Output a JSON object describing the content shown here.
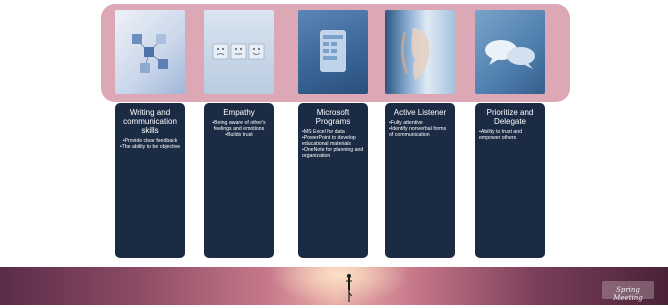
{
  "cards": [
    {
      "title": "Writing and communication skills",
      "bullets": [
        "•Provide clear feedback",
        "•The ability to be objective"
      ],
      "image_icon": "communication-network-icon"
    },
    {
      "title": "Empathy",
      "bullets": [
        "•Being aware of other's feelings and emotions",
        "•Builds trust"
      ],
      "image_icon": "emoji-faces-icon"
    },
    {
      "title": "Microsoft Programs",
      "bullets": [
        "•MS Excel for data",
        "•PowerPoint to develop educational materials",
        "•OneNote for planning and organization"
      ],
      "image_icon": "tablet-icon"
    },
    {
      "title": "Active Listener",
      "bullets": [
        "•Fully attentive",
        "•Identify nonverbal forms of communication"
      ],
      "image_icon": "listening-ear-icon"
    },
    {
      "title": "Prioritize and Delegate",
      "bullets": [
        "•Ability to trust and empower others"
      ],
      "image_icon": "speech-bubbles-icon"
    }
  ],
  "footer": {
    "logo_text": "Spring Meeting"
  },
  "colors": {
    "band": "#dca8b5",
    "card": "#1b2b44"
  }
}
